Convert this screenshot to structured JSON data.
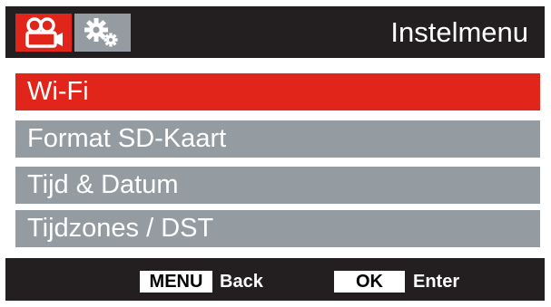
{
  "header": {
    "title": "Instelmenu",
    "tabs": [
      {
        "icon": "video-camera-icon",
        "active": true
      },
      {
        "icon": "settings-gears-icon",
        "active": false
      }
    ]
  },
  "menu": {
    "items": [
      {
        "label": "Wi-Fi",
        "selected": true
      },
      {
        "label": "Format SD-Kaart",
        "selected": false
      },
      {
        "label": "Tijd & Datum",
        "selected": false
      },
      {
        "label": "Tijdzones / DST",
        "selected": false
      }
    ]
  },
  "footer": {
    "menu_key": "MENU",
    "menu_action": "Back",
    "ok_key": "OK",
    "ok_action": "Enter"
  },
  "colors": {
    "header_bg": "#231f20",
    "accent_red": "#e1251b",
    "item_grey": "#949ca1",
    "text_white": "#ffffff"
  }
}
